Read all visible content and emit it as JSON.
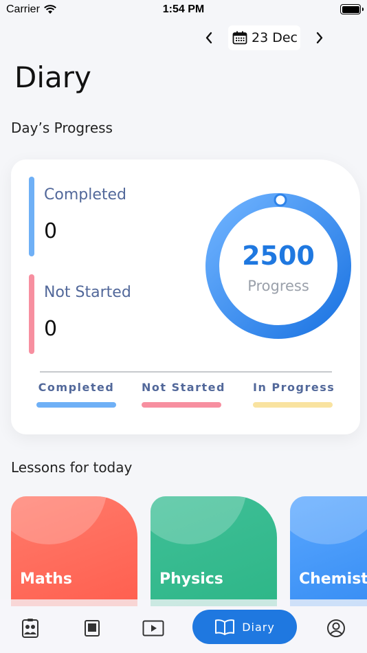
{
  "status_bar": {
    "carrier": "Carrier",
    "time": "1:54 PM"
  },
  "date_nav": {
    "date": "23 Dec"
  },
  "page": {
    "title": "Diary"
  },
  "progress": {
    "section_title": "Day’s Progress",
    "completed_label": "Completed",
    "completed_value": "0",
    "not_started_label": "Not Started",
    "not_started_value": "0",
    "ring_value": "2500",
    "ring_label": "Progress",
    "legend": [
      {
        "label": "Completed",
        "color": "#6fb0f6"
      },
      {
        "label": "Not Started",
        "color": "#f78fa0"
      },
      {
        "label": "In Progress",
        "color": "#f9e3a0"
      }
    ],
    "colors": {
      "completed": "#6fb0f6",
      "not_started": "#f78fa0",
      "ring": "#1f78e0"
    }
  },
  "lessons": {
    "section_title": "Lessons for today",
    "items": [
      {
        "name": "Maths",
        "color_from": "#ff7b6b",
        "color_to": "#ff5a4a"
      },
      {
        "name": "Physics",
        "color_from": "#3fbf97",
        "color_to": "#2bb585"
      },
      {
        "name": "Chemistry",
        "color_from": "#5aa7ff",
        "color_to": "#2d86f0"
      }
    ]
  },
  "bottom_nav": {
    "items": [
      {
        "icon": "classmates-icon"
      },
      {
        "icon": "book-icon"
      },
      {
        "icon": "video-icon"
      },
      {
        "icon": "diary-icon",
        "label": "Diary",
        "active": true
      },
      {
        "icon": "profile-icon"
      }
    ]
  }
}
